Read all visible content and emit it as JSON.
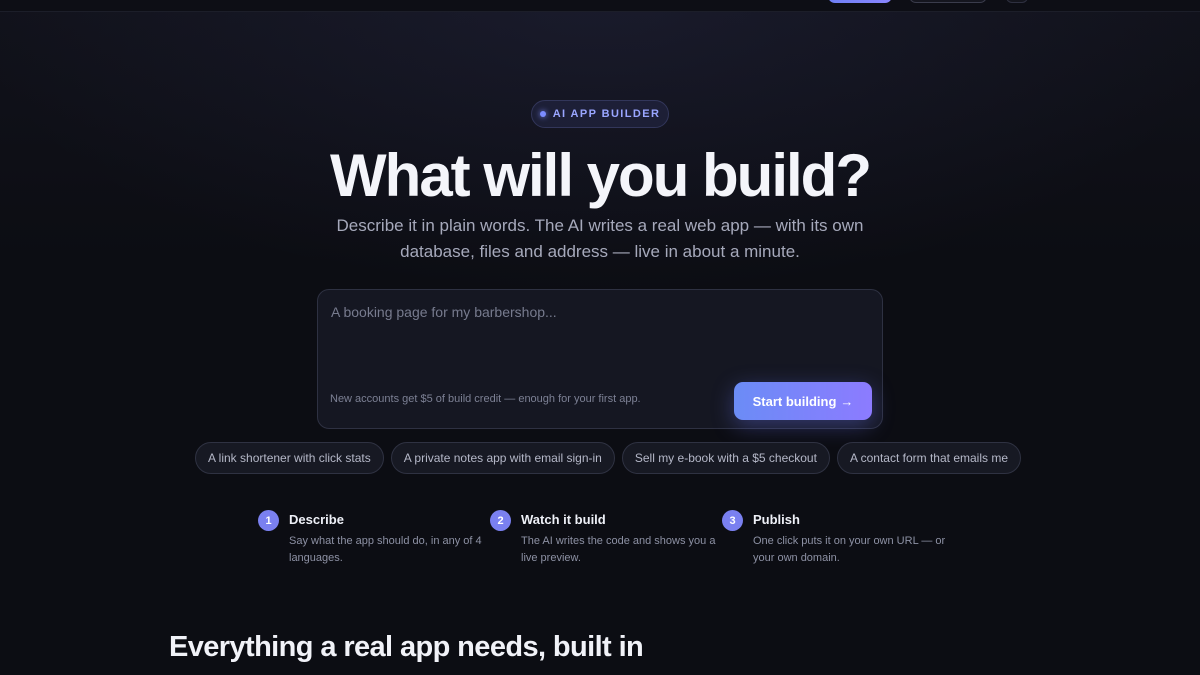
{
  "badge": {
    "label": "AI APP BUILDER"
  },
  "hero": {
    "title": "What will you build?",
    "subtitle": "Describe it in plain words. The AI writes a real web app — with its own database, files and address — live in about a minute."
  },
  "prompt": {
    "placeholder": "A booking page for my barbershop...",
    "value": "",
    "credit_note": "New accounts get $5 of build credit — enough for your first app.",
    "submit_label": "Start building",
    "submit_arrow": "→"
  },
  "suggestions": [
    "A link shortener with click stats",
    "A private notes app with email sign-in",
    "Sell my e-book with a $5 checkout",
    "A contact form that emails me"
  ],
  "steps": [
    {
      "number": "1",
      "title": "Describe",
      "description": "Say what the app should do, in any of 4 languages."
    },
    {
      "number": "2",
      "title": "Watch it build",
      "description": "The AI writes the code and shows you a live preview."
    },
    {
      "number": "3",
      "title": "Publish",
      "description": "One click puts it on your own URL — or your own domain."
    }
  ],
  "features": {
    "title": "Everything a real app needs, built in"
  },
  "colors": {
    "background": "#0c0d13",
    "accent": "#7b8cff",
    "button_gradient_start": "#6b8cf6",
    "button_gradient_end": "#8c7bff"
  }
}
